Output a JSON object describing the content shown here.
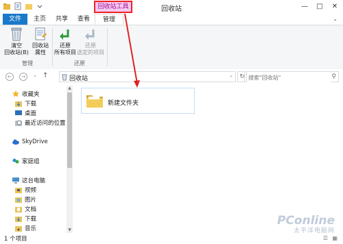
{
  "window": {
    "title": "回收站",
    "context_tab_header": "回收站工具",
    "highlight_color": "#e02020",
    "context_color": "#f6c9f2"
  },
  "tabs": {
    "file": "文件",
    "home": "主页",
    "share": "共享",
    "view": "查看",
    "manage": "管理"
  },
  "ribbon": {
    "empty_bin_line1": "清空",
    "empty_bin_line2": "回收站(B)",
    "bin_props_line1": "回收站",
    "bin_props_line2": "属性",
    "restore_all_line1": "还原",
    "restore_all_line2": "所有项目",
    "restore_sel_line1": "还原",
    "restore_sel_line2": "选定的项目",
    "group_manage": "管理",
    "group_restore": "还原"
  },
  "address": {
    "path": "回收站",
    "search_placeholder": "搜索\"回收站\""
  },
  "nav": {
    "favorites": "收藏夹",
    "downloads": "下载",
    "desktop": "桌面",
    "recent": "最近访问的位置",
    "skydrive": "SkyDrive",
    "homegroup": "家庭组",
    "thispc": "这台电脑",
    "videos": "视频",
    "pictures": "图片",
    "documents": "文档",
    "downloads2": "下载",
    "music": "音乐"
  },
  "content": {
    "items": [
      {
        "name": "新建文件夹"
      }
    ]
  },
  "status": {
    "count": "1 个项目"
  },
  "watermark": {
    "brand": "PConline",
    "tagline": "太平洋电脑网"
  }
}
